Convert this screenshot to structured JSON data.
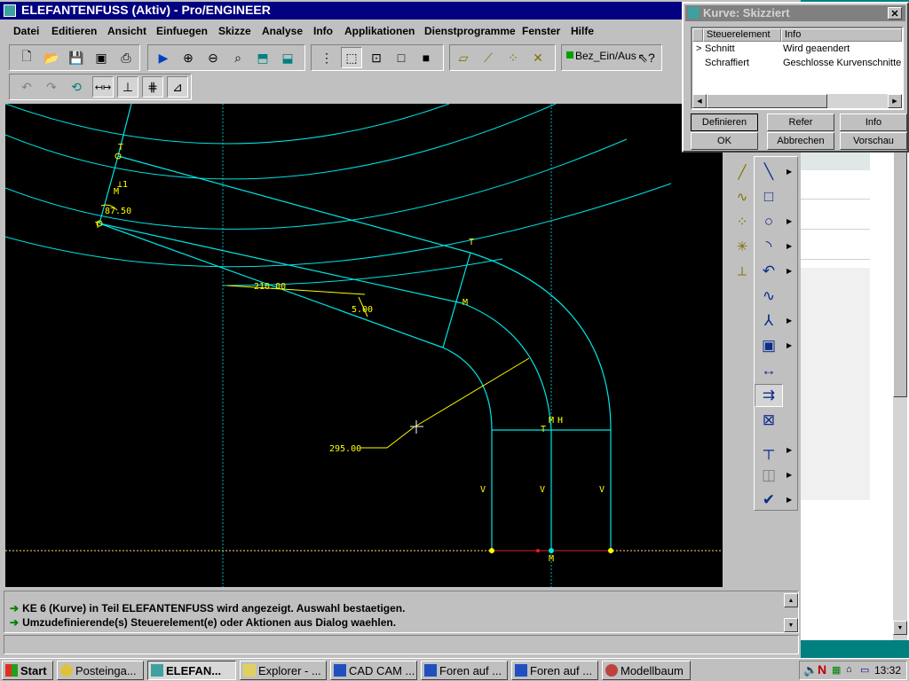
{
  "window": {
    "title": "ELEFANTENFUSS (Aktiv) - Pro/ENGINEER"
  },
  "menu": [
    "Datei",
    "Editieren",
    "Ansicht",
    "Einfuegen",
    "Skizze",
    "Analyse",
    "Info",
    "Applikationen",
    "Dienstprogramme",
    "Fenster",
    "Hilfe"
  ],
  "toolbar": {
    "file_icons": [
      "new-icon",
      "open-icon",
      "save-icon",
      "save-copy-icon",
      "print-icon"
    ],
    "view_icons": [
      "repaint-icon",
      "zoom-in-icon",
      "zoom-out-icon",
      "refit-icon",
      "orient-icon",
      "saved-views-icon"
    ],
    "display_icons": [
      "datum-planes-icon",
      "wireframe-icon",
      "hidden-line-icon",
      "no-hidden-icon",
      "shading-icon"
    ],
    "datum_icons": [
      "datum-plane-display-icon",
      "datum-axis-display-icon",
      "datum-point-display-icon",
      "coord-sys-display-icon"
    ],
    "bez_toggle": "Bez_Ein/Aus",
    "help_icon": "context-help-icon"
  },
  "toolbar2": {
    "icons": [
      "undo-icon",
      "redo-icon",
      "regenerate-icon",
      "dim-display-icon",
      "constraint-display-icon",
      "grid-display-icon",
      "vertex-display-icon"
    ]
  },
  "messages": [
    "KE 6 (Kurve) in Teil ELEFANTENFUSS wird angezeigt. Auswahl bestaetigen.",
    "Umzudefinierende(s) Steuerelement(e) oder Aktionen aus Dialog waehlen."
  ],
  "sketch": {
    "dimensions": {
      "d1": "87.50",
      "d2": "210.00",
      "d3": "5.00",
      "d4": "295.00"
    },
    "constraint_labels": {
      "tangent": "T",
      "midpoint": "M",
      "vertical": "V",
      "horizontal": "H",
      "perpendicular": "⊥1"
    },
    "colors": {
      "geometry": "#00e5e5",
      "dimension": "#ffff00",
      "centerline": "#00c8c8",
      "background": "#000000"
    }
  },
  "sketch_tools": [
    "select-icon",
    "centerline-icon",
    "line-icon",
    "rectangle-icon",
    "circle-icon",
    "arc-icon",
    "fillet-icon",
    "spline-icon",
    "point-icon",
    "coord-sys-icon",
    "use-edge-icon",
    "dimension-icon",
    "modify-icon",
    "constraints-icon",
    "text-icon",
    "mirror-icon",
    "done-icon"
  ],
  "dialog": {
    "title": "Kurve: Skizziert",
    "columns": [
      "Steuerelement",
      "Info"
    ],
    "rows": [
      {
        "marker": ">",
        "element": "Schnitt",
        "info": "Wird geaendert"
      },
      {
        "marker": "",
        "element": "Schraffiert",
        "info": "Geschlosse Kurvenschnitte"
      }
    ],
    "buttons": [
      "Definieren",
      "Refer",
      "Info",
      "OK",
      "Abbrechen",
      "Vorschau"
    ]
  },
  "taskbar": {
    "start": "Start",
    "tasks": [
      "Posteinga...",
      "ELEFAN...",
      "Explorer - ...",
      "CAD CAM ...",
      "Foren auf ...",
      "Foren auf ...",
      "Modellbaum"
    ],
    "active_index": 1,
    "clock": "13:32"
  }
}
